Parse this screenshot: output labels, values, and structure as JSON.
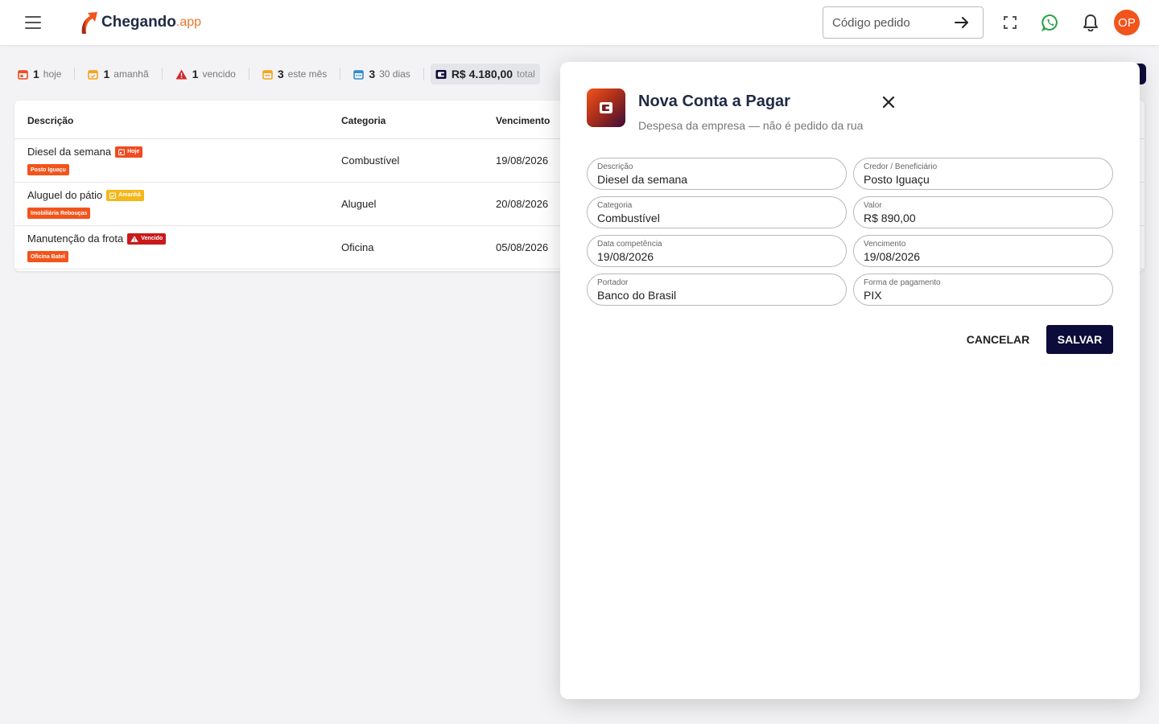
{
  "app": {
    "logo_main": "Chegando",
    "logo_sub": ".app",
    "order_search_placeholder": "Código pedido",
    "avatar_initials": "OP"
  },
  "summary": {
    "today": {
      "count": "1",
      "label": "hoje"
    },
    "tomorrow": {
      "count": "1",
      "label": "amanhã"
    },
    "overdue": {
      "count": "1",
      "label": "vencido"
    },
    "month": {
      "count": "3",
      "label": "este mês"
    },
    "days30": {
      "count": "3",
      "label": "30 dias"
    },
    "total": {
      "value": "R$ 4.180,00",
      "label": "total"
    }
  },
  "table": {
    "headers": {
      "description": "Descrição",
      "category": "Categoria",
      "due": "Vencimento"
    },
    "rows": [
      {
        "description": "Diesel da semana",
        "badge": "Hoje",
        "creditor": "Posto Iguaçu",
        "category": "Combustível",
        "due": "19/08/2026"
      },
      {
        "description": "Aluguel do pátio",
        "badge": "Amanhã",
        "creditor": "Imobiliária Rebouças",
        "category": "Aluguel",
        "due": "20/08/2026"
      },
      {
        "description": "Manutenção da frota",
        "badge": "Vencido",
        "creditor": "Oficina Batel",
        "category": "Oficina",
        "due": "05/08/2026"
      }
    ]
  },
  "modal": {
    "title": "Nova Conta a Pagar",
    "subtitle": "Despesa da empresa — não é pedido da rua",
    "fields": {
      "description": {
        "label": "Descrição",
        "value": "Diesel da semana"
      },
      "creditor": {
        "label": "Credor / Beneficiário",
        "value": "Posto Iguaçu"
      },
      "category": {
        "label": "Categoria",
        "value": "Combustível"
      },
      "amount": {
        "label": "Valor",
        "value": "R$ 890,00"
      },
      "accrual_date": {
        "label": "Data competência",
        "value": "19/08/2026"
      },
      "due_date": {
        "label": "Vencimento",
        "value": "19/08/2026"
      },
      "bearer": {
        "label": "Portador",
        "value": "Banco do Brasil"
      },
      "payment_method": {
        "label": "Forma de pagamento",
        "value": "PIX"
      }
    },
    "cancel_label": "CANCELAR",
    "save_label": "SALVAR"
  },
  "colors": {
    "brand_orange": "#f2541b",
    "navy": "#0c0c3a",
    "today": "#f04b23",
    "tomorrow": "#f5b81c",
    "overdue": "#c91a1a",
    "whatsapp": "#25a244"
  },
  "icons": {
    "menu": "hamburger-icon",
    "logo": "arrow-logo-icon",
    "go": "arrow-right-icon",
    "fullscreen": "fullscreen-icon",
    "whatsapp": "whatsapp-icon",
    "notifications": "bell-icon",
    "calendar": "calendar-icon",
    "warning": "warning-icon",
    "wallet": "wallet-icon",
    "close": "close-icon"
  }
}
